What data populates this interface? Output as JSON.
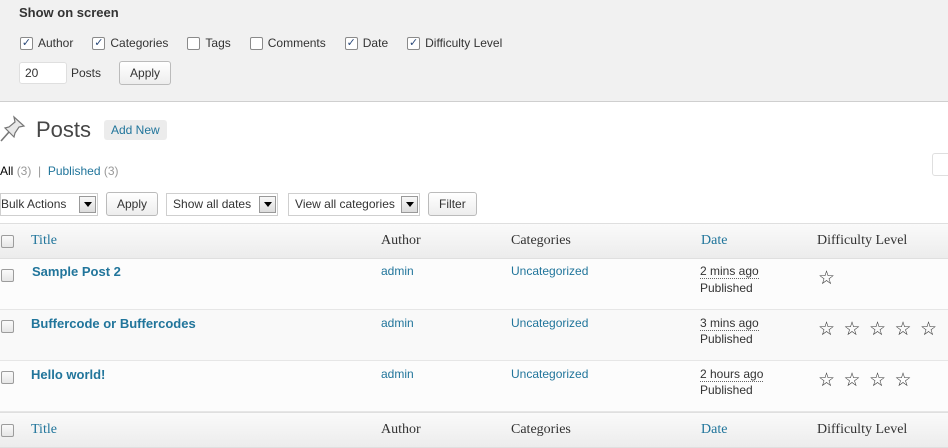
{
  "screen_options": {
    "title": "Show on screen",
    "columns": [
      {
        "label": "Author",
        "checked": true
      },
      {
        "label": "Categories",
        "checked": true
      },
      {
        "label": "Tags",
        "checked": false
      },
      {
        "label": "Comments",
        "checked": false
      },
      {
        "label": "Date",
        "checked": true
      },
      {
        "label": "Difficulty Level",
        "checked": true
      }
    ],
    "per_page_value": "20",
    "per_page_label": "Posts",
    "apply_label": "Apply"
  },
  "header": {
    "title": "Posts",
    "add_new_label": "Add New"
  },
  "filters_links": {
    "all_label": "All",
    "all_count": "(3)",
    "separator": "|",
    "published_label": "Published",
    "published_count": "(3)"
  },
  "tablenav": {
    "bulk_actions": "Bulk Actions",
    "apply_label": "Apply",
    "dates": "Show all dates",
    "categories": "View all categories",
    "filter_label": "Filter"
  },
  "columns": {
    "title": "Title",
    "author": "Author",
    "categories": "Categories",
    "date": "Date",
    "difficulty": "Difficulty Level"
  },
  "rows": [
    {
      "title": "Sample Post 2",
      "author": "admin",
      "category": "Uncategorized",
      "date_ago": "2 mins ago",
      "status": "Published",
      "stars": 1
    },
    {
      "title": "Buffercode or Buffercodes",
      "author": "admin",
      "category": "Uncategorized",
      "date_ago": "3 mins ago",
      "status": "Published",
      "stars": 5
    },
    {
      "title": "Hello world!",
      "author": "admin",
      "category": "Uncategorized",
      "date_ago": "2 hours ago",
      "status": "Published",
      "stars": 4
    }
  ],
  "icons": {
    "pin": "pushpin-icon",
    "star": "star-outline-icon",
    "check": "checkmark-icon",
    "dropdown": "chevron-down-icon"
  },
  "colors": {
    "link": "#21759b",
    "panel_bg": "#f1f1f1"
  }
}
